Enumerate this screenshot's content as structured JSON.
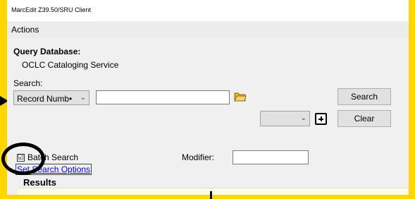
{
  "window": {
    "title": "MarcEdit Z39.50/SRU Client"
  },
  "menu": {
    "actions": "Actions"
  },
  "query": {
    "heading": "Query Database:",
    "database": "OCLC Cataloging Service",
    "search_label": "Search:",
    "field_select": "Record Numb•",
    "search_value": ""
  },
  "buttons": {
    "search": "Search",
    "clear": "Clear"
  },
  "batch": {
    "label": "Batch Search",
    "checked": "☑"
  },
  "modifier": {
    "label": "Modifier:",
    "value": ""
  },
  "options_link": "Set Search Options",
  "results": {
    "heading": "Results"
  }
}
